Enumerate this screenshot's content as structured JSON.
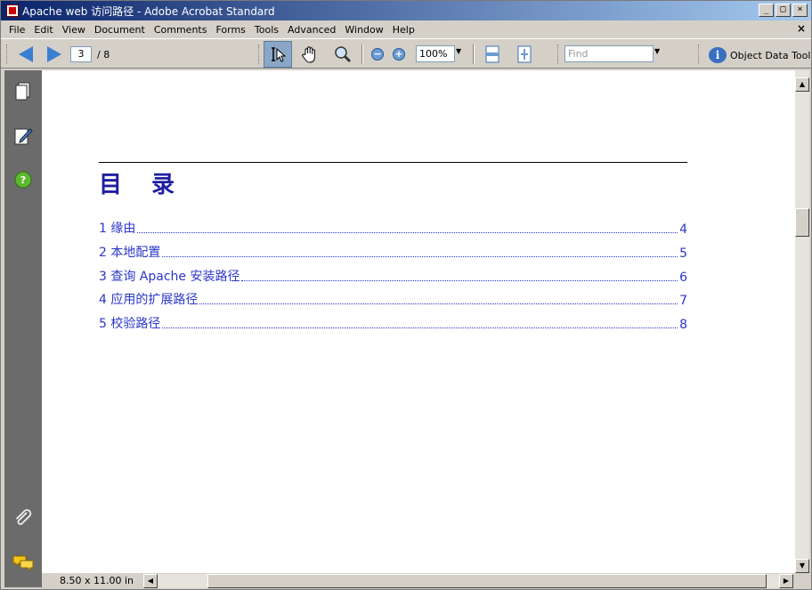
{
  "window": {
    "title": "Apache web 访问路径 - Adobe Acrobat Standard",
    "buttons": [
      "_",
      "□",
      "×"
    ]
  },
  "menu": {
    "items": [
      "File",
      "Edit",
      "View",
      "Document",
      "Comments",
      "Forms",
      "Tools",
      "Advanced",
      "Window",
      "Help"
    ],
    "close": "×"
  },
  "toolbar": {
    "current_page": "3",
    "total_pages": "/ 8",
    "zoom": "100%",
    "find_placeholder": "Find",
    "object_data_tool": "Object Data Tool"
  },
  "document": {
    "toc_title": "目 录",
    "toc": [
      {
        "label": "1 缘由",
        "page": "4"
      },
      {
        "label": "2 本地配置",
        "page": "5"
      },
      {
        "label": "3 查询 Apache 安装路径",
        "page": "6"
      },
      {
        "label": "4 应用的扩展路径",
        "page": "7"
      },
      {
        "label": "5 校验路径",
        "page": "8"
      }
    ]
  },
  "status": {
    "page_size": "8.50 x 11.00 in"
  },
  "colors": {
    "toc_link": "#2a36c8",
    "title_bar_start": "#0a246a",
    "title_bar_end": "#a6caf0",
    "nav_panel": "#6b6b6b"
  }
}
